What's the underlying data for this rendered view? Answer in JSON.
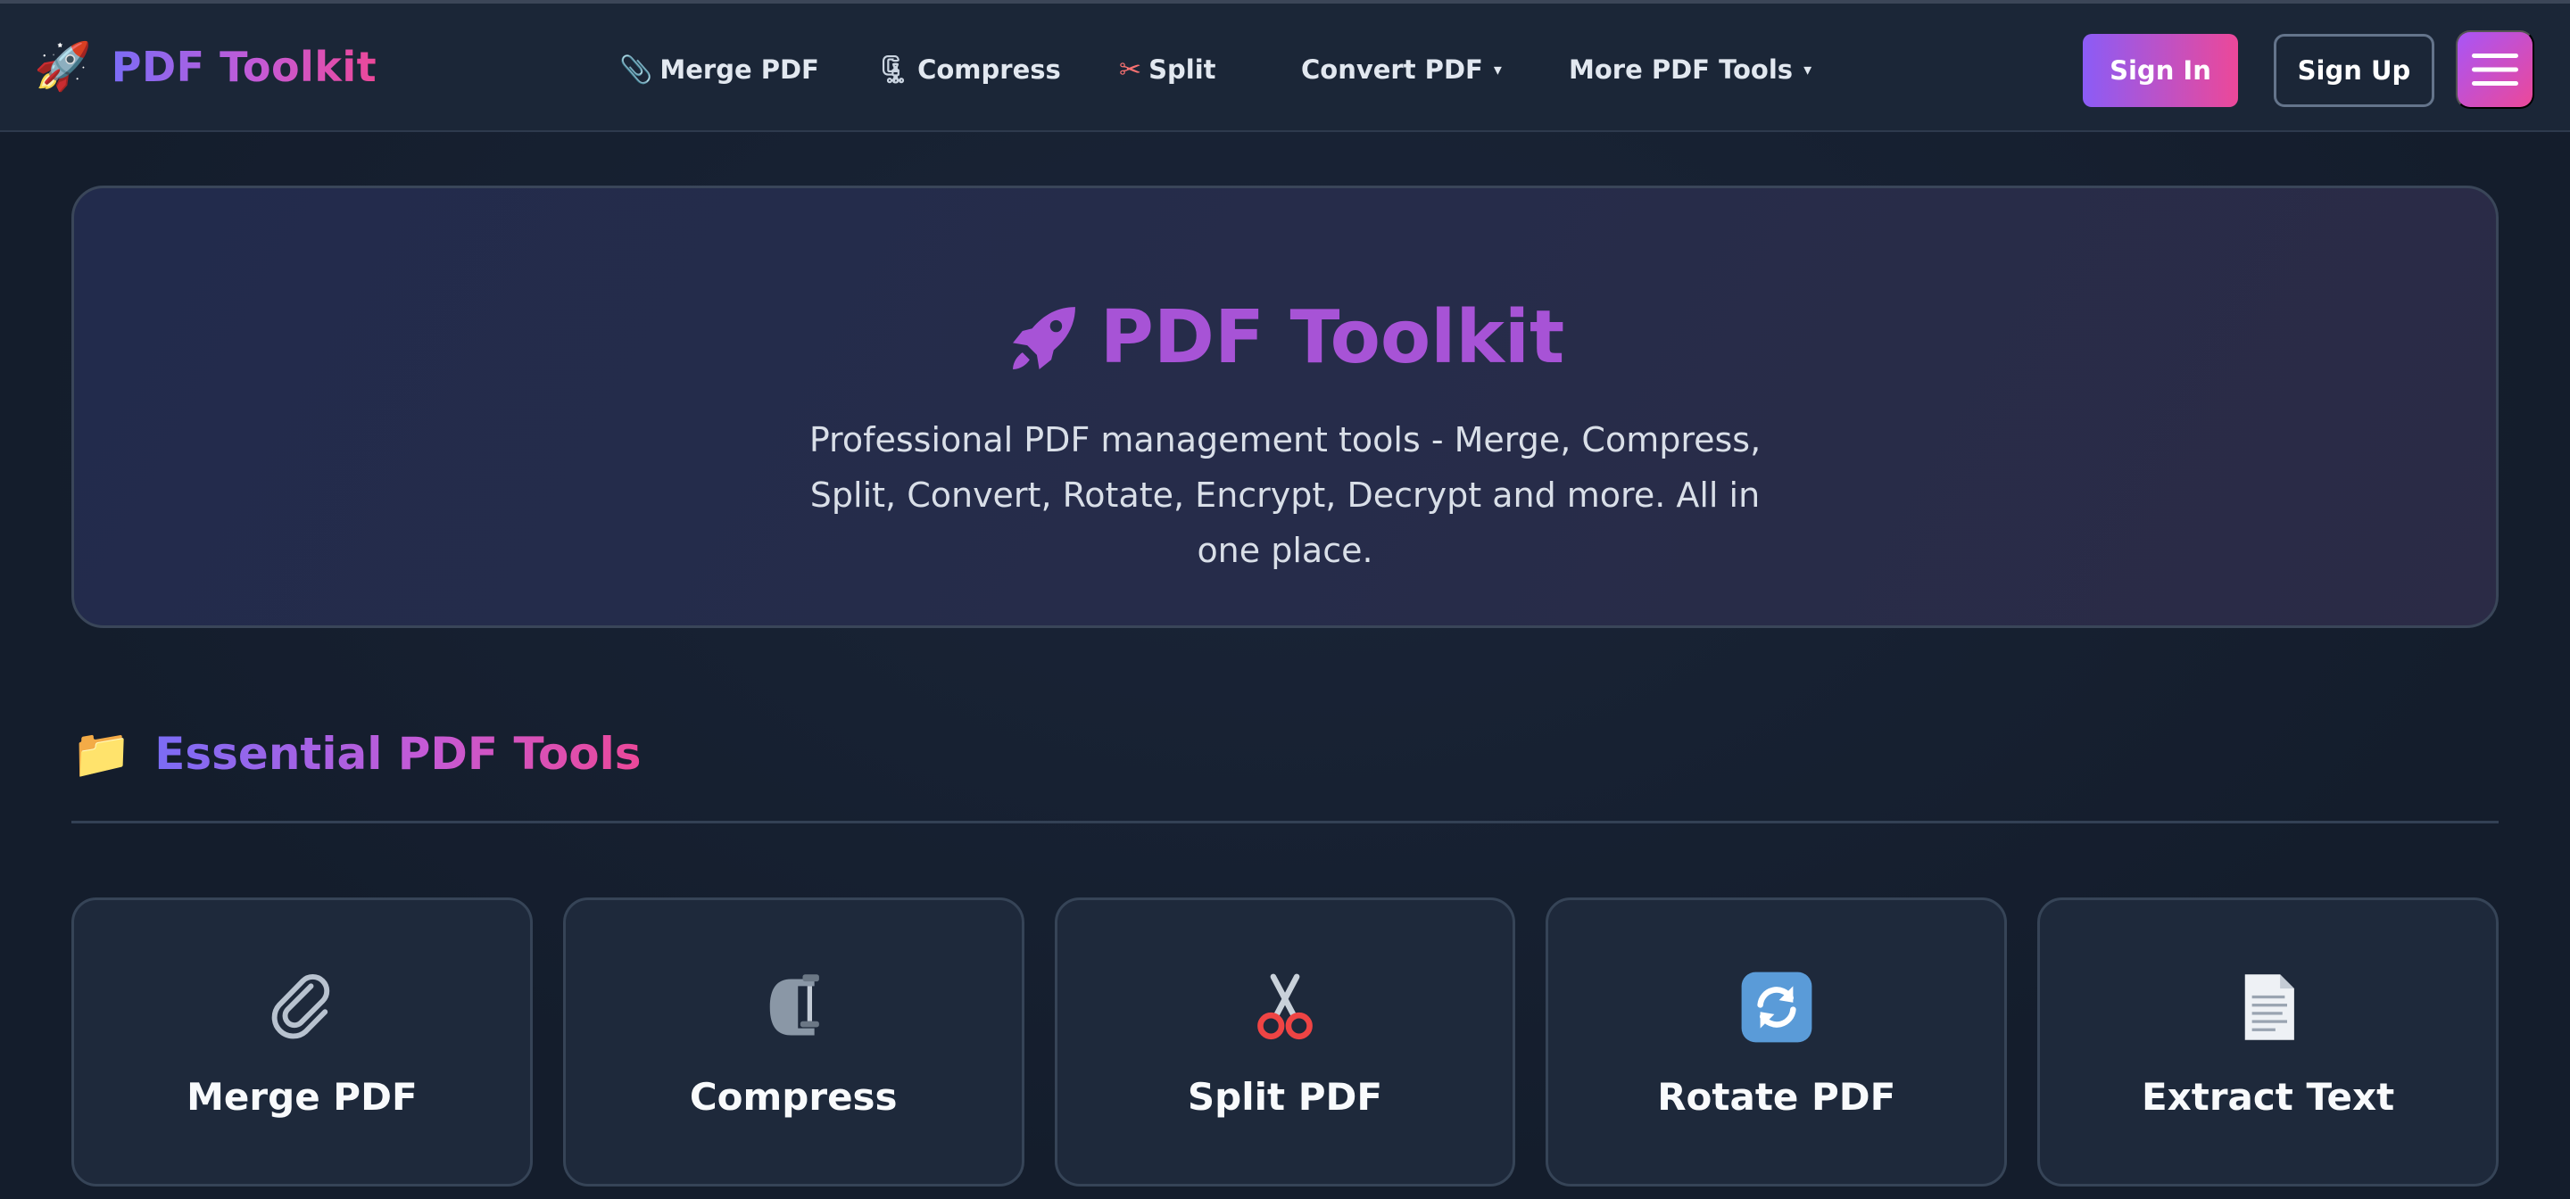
{
  "navbar": {
    "brand": {
      "icon": "rocket-icon",
      "title": "PDF Toolkit"
    },
    "links": [
      {
        "label": "Merge PDF",
        "icon": "paperclip-icon"
      },
      {
        "label": "Compress",
        "icon": "clamp-icon"
      },
      {
        "label": "Split",
        "icon": "scissors-icon"
      },
      {
        "label": "Convert PDF",
        "dropdown": true
      },
      {
        "label": "More PDF Tools",
        "dropdown": true
      }
    ],
    "sign_in": "Sign In",
    "sign_up": "Sign Up",
    "menu_icon": "hamburger-icon"
  },
  "hero": {
    "icon": "rocket-icon",
    "title": "PDF Toolkit",
    "description": "Professional PDF management tools - Merge, Compress, Split, Convert, Rotate, Encrypt, Decrypt and more. All in one place."
  },
  "section": {
    "icon": "folder-icon",
    "title": "Essential PDF Tools"
  },
  "tools": [
    {
      "label": "Merge PDF",
      "icon": "paperclip-icon"
    },
    {
      "label": "Compress",
      "icon": "clamp-icon"
    },
    {
      "label": "Split PDF",
      "icon": "scissors-icon"
    },
    {
      "label": "Rotate PDF",
      "icon": "rotate-arrows-icon"
    },
    {
      "label": "Extract Text",
      "icon": "document-icon"
    }
  ],
  "colors": {
    "background": "#162031",
    "navbar": "#1b2637",
    "card": "#1e293b",
    "accent_purple": "#8b5cf6",
    "accent_pink": "#ec4899",
    "hero_title": "#a753d6"
  }
}
